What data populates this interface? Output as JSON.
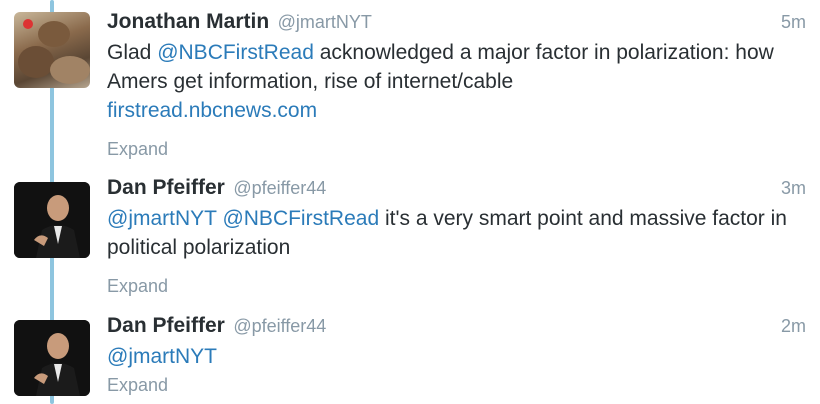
{
  "tweets": [
    {
      "name": "Jonathan Martin",
      "handle": "@jmartNYT",
      "time": "5m",
      "text_before": "Glad ",
      "mention": "@NBCFirstRead",
      "text_after": " acknowledged a major factor in polarization: how Amers get information, rise of internet/cable",
      "link": "firstread.nbcnews.com",
      "expand": "Expand"
    },
    {
      "name": "Dan Pfeiffer",
      "handle": "@pfeiffer44",
      "time": "3m",
      "mention1": "@jmartNYT",
      "mention2": "@NBCFirstRead",
      "text": " it's a very smart point and massive factor in political polarization",
      "expand": "Expand"
    },
    {
      "name": "Dan Pfeiffer",
      "handle": "@pfeiffer44",
      "time": "2m",
      "mention": "@jmartNYT",
      "expand": "Expand"
    }
  ]
}
